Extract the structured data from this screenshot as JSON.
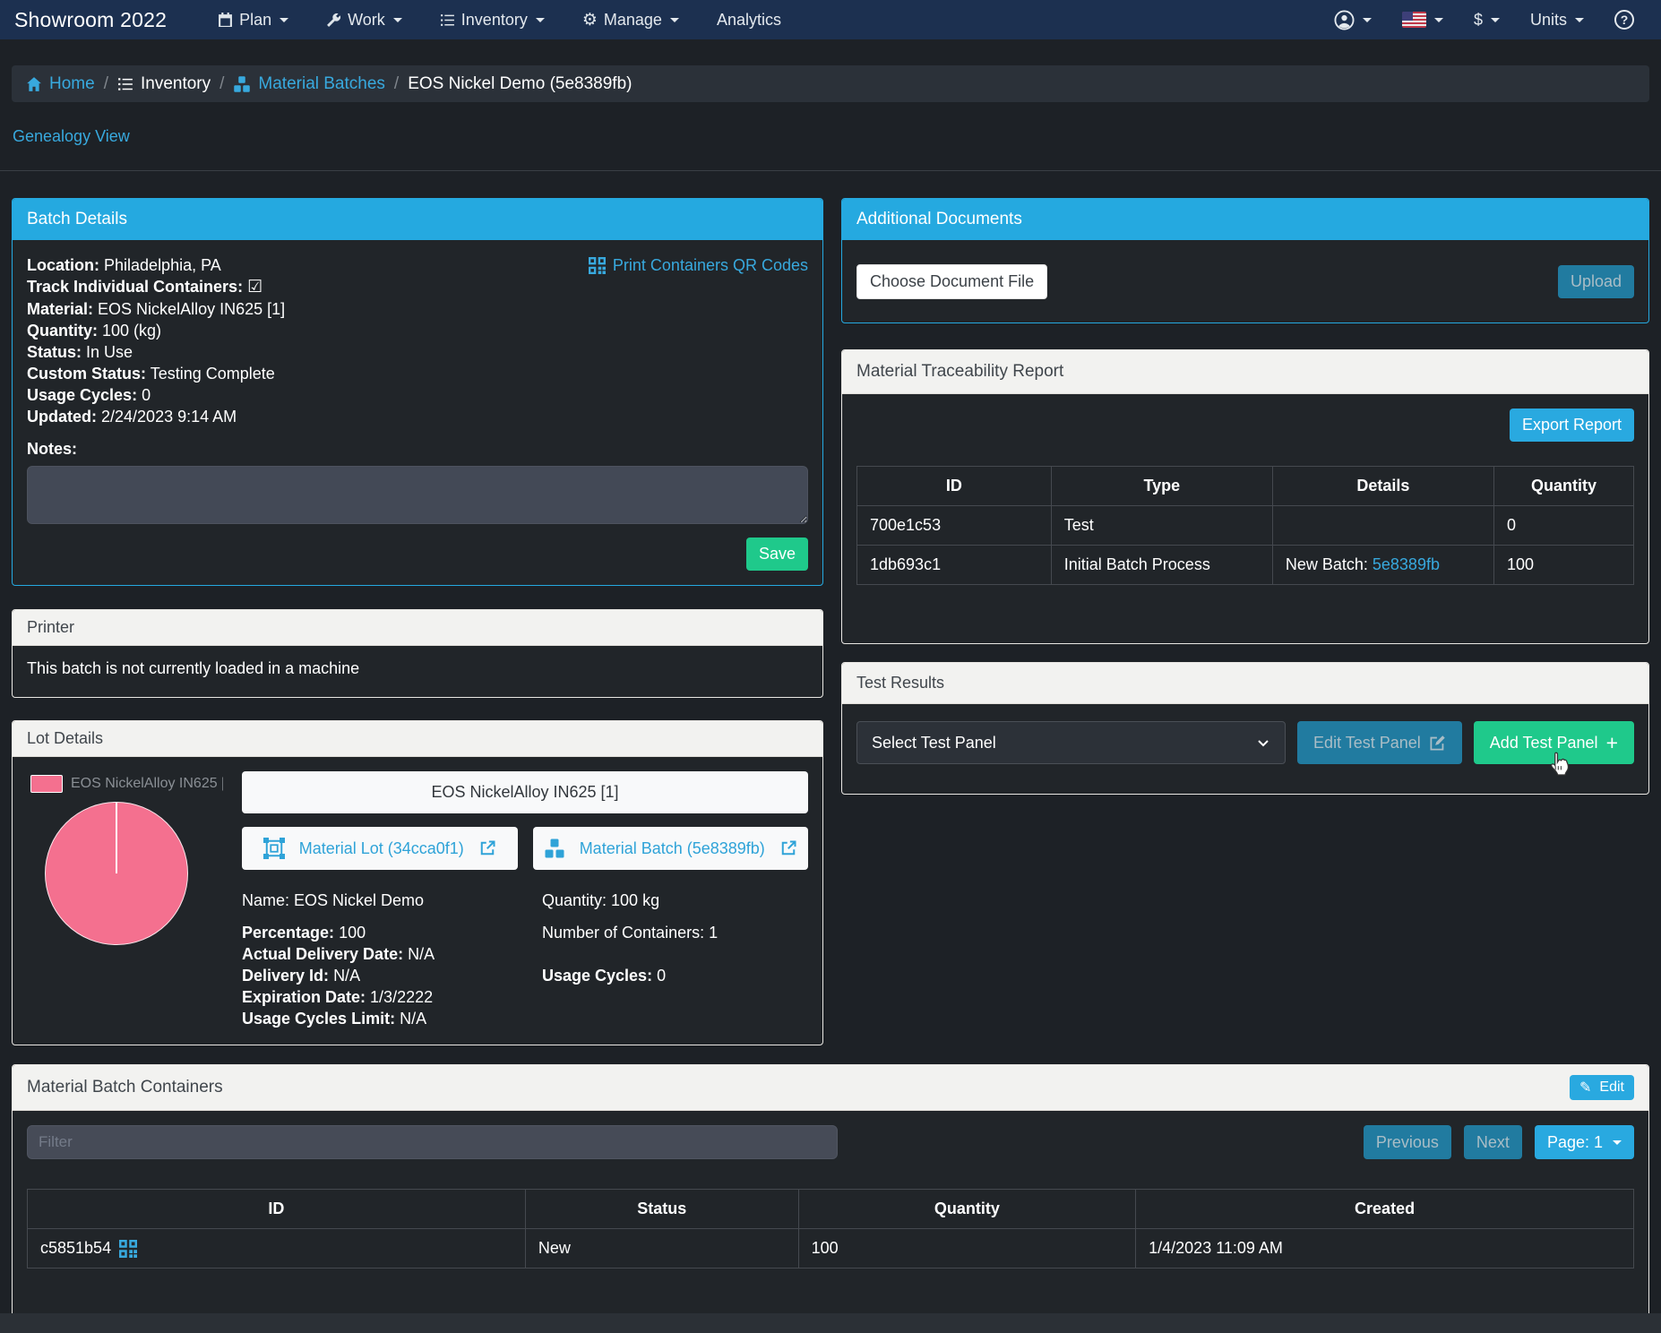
{
  "navbar": {
    "brand": "Showroom 2022",
    "items": [
      {
        "label": "Plan"
      },
      {
        "label": "Work"
      },
      {
        "label": "Inventory"
      },
      {
        "label": "Manage"
      },
      {
        "label": "Analytics"
      }
    ],
    "dollar": "$",
    "units": "Units"
  },
  "breadcrumb": {
    "separator": "/",
    "home": "Home",
    "inventory": "Inventory",
    "material_batches": "Material Batches",
    "current": "EOS Nickel Demo (5e8389fb)"
  },
  "genealogy_link": "Genealogy View",
  "batch_details": {
    "title": "Batch Details",
    "qr_link": "Print Containers QR Codes",
    "location_label": "Location:",
    "location": "Philadelphia, PA",
    "track_label": "Track Individual Containers:",
    "material_label": "Material:",
    "material": "EOS NickelAlloy IN625 [1]",
    "quantity_label": "Quantity:",
    "quantity": "100 (kg)",
    "status_label": "Status:",
    "status": "In Use",
    "custom_status_label": "Custom Status:",
    "custom_status": "Testing Complete",
    "usage_cycles_label": "Usage Cycles:",
    "usage_cycles": "0",
    "updated_label": "Updated:",
    "updated": "2/24/2023 9:14 AM",
    "notes_label": "Notes:",
    "notes_value": "",
    "save_label": "Save"
  },
  "printer": {
    "title": "Printer",
    "message": "This batch is not currently loaded in a machine"
  },
  "lot_details": {
    "title": "Lot Details",
    "legend_label": "EOS NickelAlloy IN625 [1]",
    "material_title": "EOS NickelAlloy IN625 [1]",
    "lot_link": "Material Lot (34cca0f1)",
    "batch_link": "Material Batch (5e8389fb)",
    "name": "Name: EOS Nickel Demo",
    "percentage_label": "Percentage:",
    "percentage": "100",
    "actual_delivery_label": "Actual Delivery Date:",
    "actual_delivery": "N/A",
    "delivery_id_label": "Delivery Id:",
    "delivery_id": "N/A",
    "expiration_label": "Expiration Date:",
    "expiration": "1/3/2222",
    "usage_limit_label": "Usage Cycles Limit:",
    "usage_limit": "N/A",
    "quantity": "Quantity: 100 kg",
    "containers": "Number of Containers: 1",
    "usage_cycles_label": "Usage Cycles:",
    "usage_cycles": "0"
  },
  "additional_documents": {
    "title": "Additional Documents",
    "choose_label": "Choose Document File",
    "upload_label": "Upload"
  },
  "traceability": {
    "title": "Material Traceability Report",
    "export_label": "Export Report",
    "columns": [
      "ID",
      "Type",
      "Details",
      "Quantity"
    ],
    "rows": [
      {
        "id": "700e1c53",
        "type": "Test",
        "details_prefix": "",
        "details_link": "",
        "quantity": "0"
      },
      {
        "id": "1db693c1",
        "type": "Initial Batch Process",
        "details_prefix": "New Batch: ",
        "details_link": "5e8389fb",
        "quantity": "100"
      }
    ]
  },
  "test_results": {
    "title": "Test Results",
    "select_value": "Select Test Panel",
    "edit_label": "Edit Test Panel",
    "add_label": "Add Test Panel"
  },
  "containers": {
    "title": "Material Batch Containers",
    "edit_label": "Edit",
    "filter_placeholder": "Filter",
    "previous_label": "Previous",
    "next_label": "Next",
    "page_label": "Page: 1",
    "columns": [
      "ID",
      "Status",
      "Quantity",
      "Created"
    ],
    "rows": [
      {
        "id": "c5851b54",
        "status": "New",
        "quantity": "100",
        "created": "1/4/2023 11:09 AM"
      }
    ]
  },
  "icons": {
    "checkbox_checked": "☑",
    "gear": "⚙",
    "pencil": "✎",
    "plus": "+",
    "question": "?"
  },
  "colors": {
    "accent_cyan": "#25a9e0",
    "green": "#1fc98b",
    "pink": "#f4708f",
    "navy": "#1c3050"
  }
}
